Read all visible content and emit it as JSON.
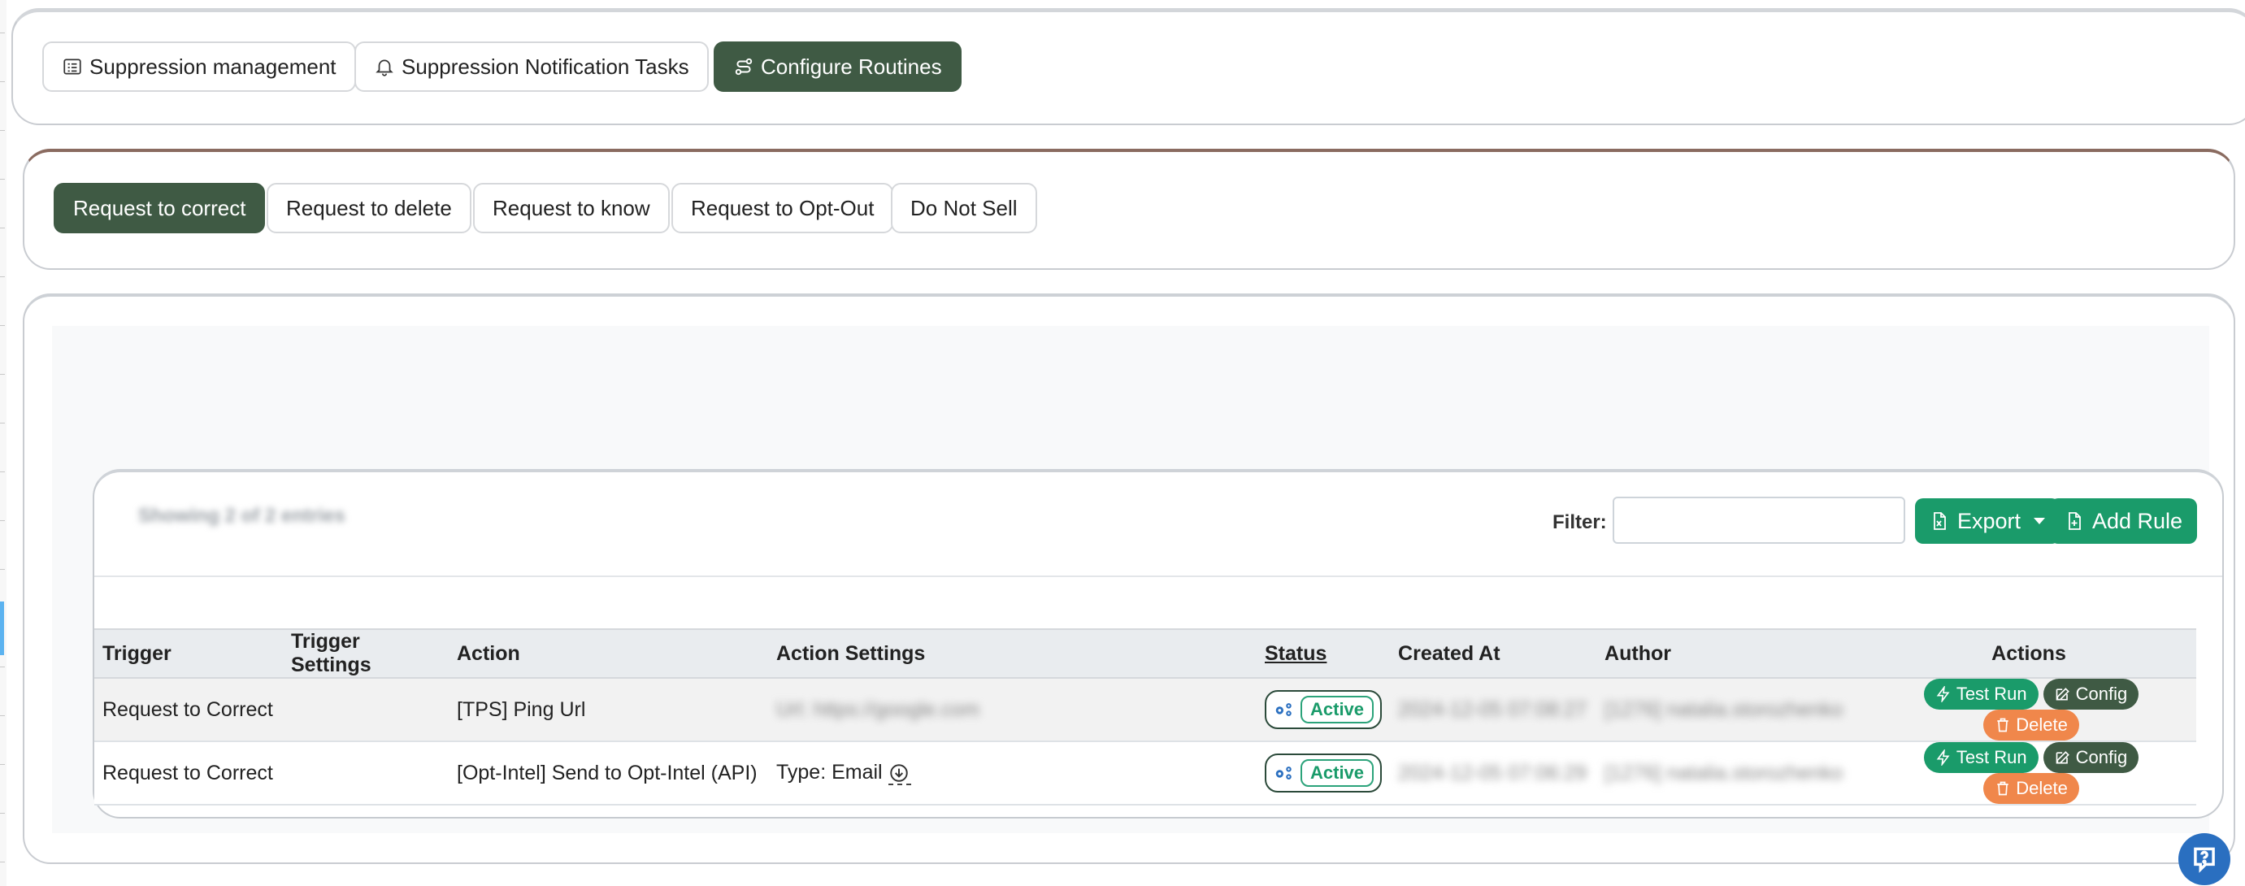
{
  "top_tabs": [
    {
      "label": "Suppression management",
      "icon": "list-icon",
      "active": false
    },
    {
      "label": "Suppression Notification Tasks",
      "icon": "bell-icon",
      "active": false
    },
    {
      "label": "Configure Routines",
      "icon": "route-icon",
      "active": true
    }
  ],
  "sub_tabs": [
    {
      "label": "Request to correct",
      "active": true
    },
    {
      "label": "Request to delete",
      "active": false
    },
    {
      "label": "Request to know",
      "active": false
    },
    {
      "label": "Request to Opt-Out",
      "active": false
    },
    {
      "label": "Do Not Sell",
      "active": false
    }
  ],
  "table_panel": {
    "showing_text": "Showing 2 of 2 entries",
    "filter_label": "Filter:",
    "filter_value": "",
    "export_label": "Export",
    "add_rule_label": "Add Rule"
  },
  "table": {
    "headers": {
      "trigger": "Trigger",
      "trigger_settings": "Trigger Settings",
      "action": "Action",
      "action_settings": "Action Settings",
      "status": "Status",
      "created_at": "Created At",
      "author": "Author",
      "actions": "Actions"
    },
    "rows": [
      {
        "trigger": "Request to Correct",
        "trigger_settings": "",
        "action": "[TPS] Ping Url",
        "action_settings": "Url: https://google.com",
        "status": "Active",
        "created_at": "2024-12-05 07:08:27",
        "author": "[1276] natalia.storozhenko"
      },
      {
        "trigger": "Request to Correct",
        "trigger_settings": "",
        "action": "[Opt-Intel] Send to Opt-Intel (API)",
        "action_settings": "Type: Email",
        "status": "Active",
        "created_at": "2024-12-05 07:06:29",
        "author": "[1276] natalia.storozhenko"
      }
    ],
    "row_buttons": {
      "test_run": "Test Run",
      "config": "Config",
      "delete": "Delete"
    }
  },
  "colors": {
    "active_tab": "#3f5a44",
    "primary_green": "#1a9b6a",
    "delete_orange": "#f0874b",
    "help_blue": "#2a6fc0"
  }
}
